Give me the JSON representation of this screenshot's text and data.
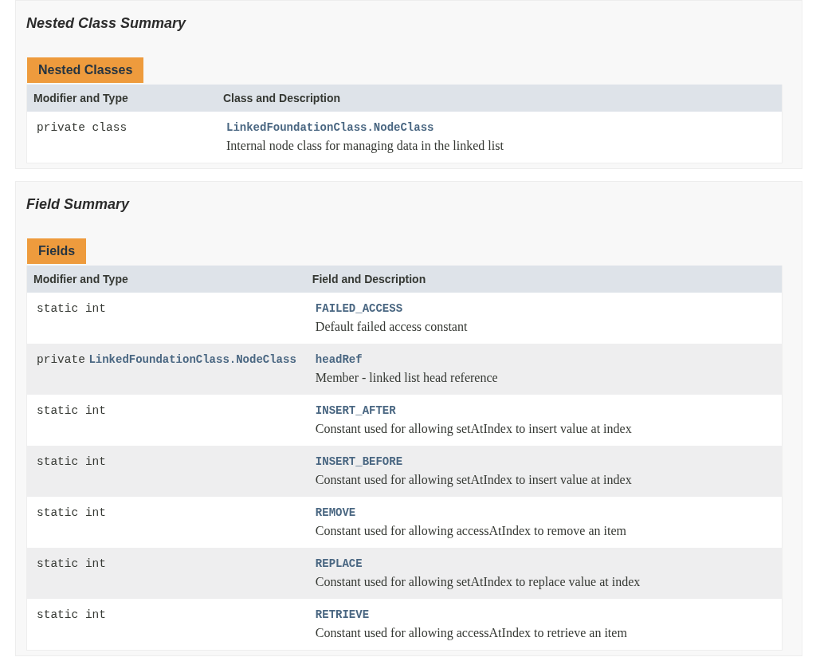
{
  "sections": [
    {
      "title": "Nested Class Summary",
      "caption": "Nested Classes",
      "columns": [
        "Modifier and Type",
        "Class and Description"
      ],
      "rows": [
        {
          "type": "private class",
          "type_link": "",
          "name": "LinkedFoundationClass.NodeClass",
          "description": "Internal node class for managing data in the linked list"
        }
      ]
    },
    {
      "title": "Field Summary",
      "caption": "Fields",
      "columns": [
        "Modifier and Type",
        "Field and Description"
      ],
      "rows": [
        {
          "type": "static int",
          "type_link": "",
          "name": "FAILED_ACCESS",
          "description": "Default failed access constant"
        },
        {
          "type": "private",
          "type_link": "LinkedFoundationClass.NodeClass",
          "name": "headRef",
          "description": "Member - linked list head reference"
        },
        {
          "type": "static int",
          "type_link": "",
          "name": "INSERT_AFTER",
          "description": "Constant used for allowing setAtIndex to insert value at index"
        },
        {
          "type": "static int",
          "type_link": "",
          "name": "INSERT_BEFORE",
          "description": "Constant used for allowing setAtIndex to insert value at index"
        },
        {
          "type": "static int",
          "type_link": "",
          "name": "REMOVE",
          "description": "Constant used for allowing accessAtIndex to remove an item"
        },
        {
          "type": "static int",
          "type_link": "",
          "name": "REPLACE",
          "description": "Constant used for allowing setAtIndex to replace value at index"
        },
        {
          "type": "static int",
          "type_link": "",
          "name": "RETRIEVE",
          "description": "Constant used for allowing accessAtIndex to retrieve an item"
        }
      ]
    }
  ]
}
